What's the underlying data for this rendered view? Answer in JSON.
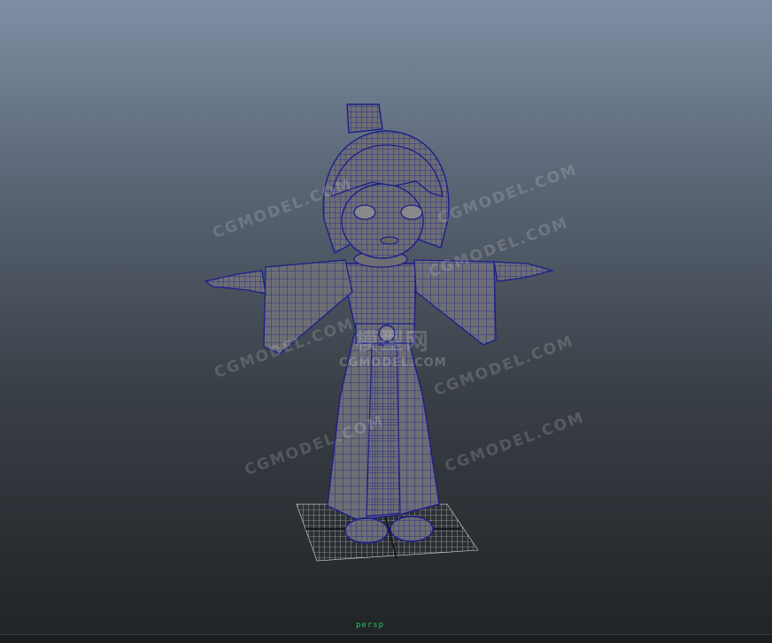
{
  "viewport": {
    "camera_label": "persp",
    "watermark_text": "CGMODEL.COM",
    "watermark_main": "模型网",
    "watermark_sub": "CGMODEL.COM"
  },
  "colors": {
    "wireframe": "#1b1f8a",
    "mesh_fill": "#6e6e70",
    "grid": "#d8d8d8",
    "camera_label": "#1ec75a"
  },
  "model": {
    "type": "character-wireframe",
    "description_icon": "character-mesh-icon"
  }
}
